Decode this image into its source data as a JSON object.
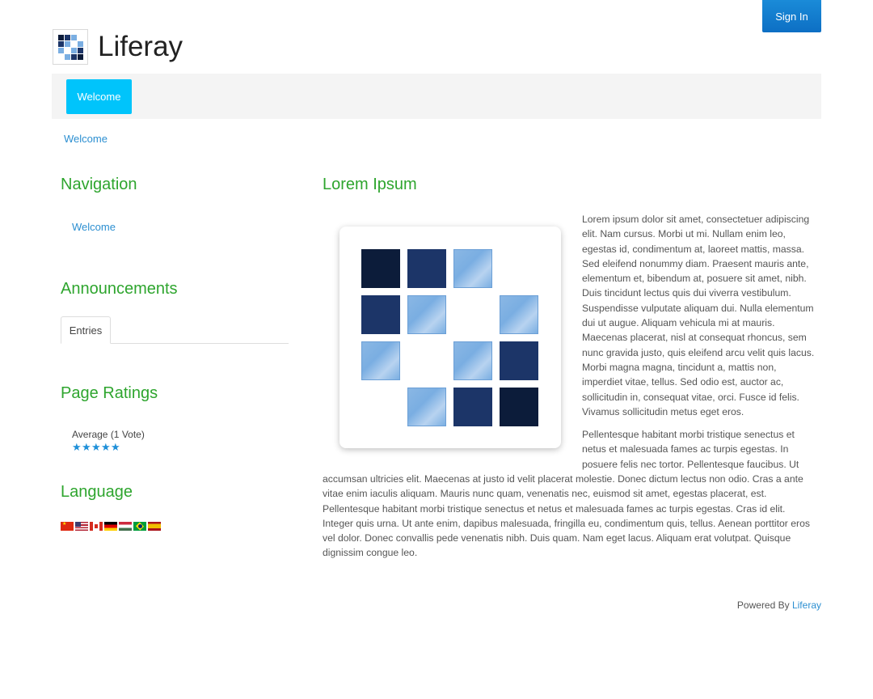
{
  "header": {
    "sign_in_label": "Sign In",
    "brand_name": "Liferay"
  },
  "navbar": {
    "tabs": [
      {
        "label": "Welcome",
        "active": true
      }
    ]
  },
  "breadcrumb": {
    "items": [
      "Welcome"
    ]
  },
  "navigation_portlet": {
    "title": "Navigation",
    "items": [
      "Welcome"
    ]
  },
  "announcements_portlet": {
    "title": "Announcements",
    "tabs": [
      "Entries"
    ]
  },
  "page_ratings_portlet": {
    "title": "Page Ratings",
    "summary": "Average (1 Vote)",
    "stars_filled": 5,
    "stars_total": 5
  },
  "language_portlet": {
    "title": "Language",
    "flags": [
      "china-flag-icon",
      "usa-flag-icon",
      "canada-flag-icon",
      "germany-flag-icon",
      "hungary-flag-icon",
      "brazil-flag-icon",
      "spain-flag-icon"
    ]
  },
  "article": {
    "title": "Lorem Ipsum",
    "paragraph1": "Lorem ipsum dolor sit amet, consectetuer adipiscing elit. Nam cursus. Morbi ut mi. Nullam enim leo, egestas id, condimentum at, laoreet mattis, massa. Sed eleifend nonummy diam. Praesent mauris ante, elementum et, bibendum at, posuere sit amet, nibh. Duis tincidunt lectus quis dui viverra vestibulum. Suspendisse vulputate aliquam dui. Nulla elementum dui ut augue. Aliquam vehicula mi at mauris. Maecenas placerat, nisl at consequat rhoncus, sem nunc gravida justo, quis eleifend arcu velit quis lacus. Morbi magna magna, tincidunt a, mattis non, imperdiet vitae, tellus. Sed odio est, auctor ac, sollicitudin in, consequat vitae, orci. Fusce id felis. Vivamus sollicitudin metus eget eros.",
    "paragraph2_top": "Pellentesque habitant morbi tristique senectus et netus et malesuada fames ac turpis egestas. In posuere felis nec tortor. Pellentesque faucibus. Ut",
    "paragraph2_bottom": "accumsan ultricies elit. Maecenas at justo id velit placerat molestie. Donec dictum lectus non odio. Cras a ante vitae enim iaculis aliquam. Mauris nunc quam, venenatis nec, euismod sit amet, egestas placerat, est. Pellentesque habitant morbi tristique senectus et netus et malesuada fames ac turpis egestas. Cras id elit. Integer quis urna. Ut ante enim, dapibus malesuada, fringilla eu, condimentum quis, tellus. Aenean porttitor eros vel dolor. Donec convallis pede venenatis nibh. Duis quam. Nam eget lacus. Aliquam erat volutpat. Quisque dignissim congue leo."
  },
  "footer": {
    "powered_by": "Powered By",
    "link_label": "Liferay"
  },
  "colors": {
    "accent_blue": "#1a8bd8",
    "nav_tab": "#00c4fb",
    "portlet_title": "#2ea52e",
    "link": "#2c8fd1"
  }
}
